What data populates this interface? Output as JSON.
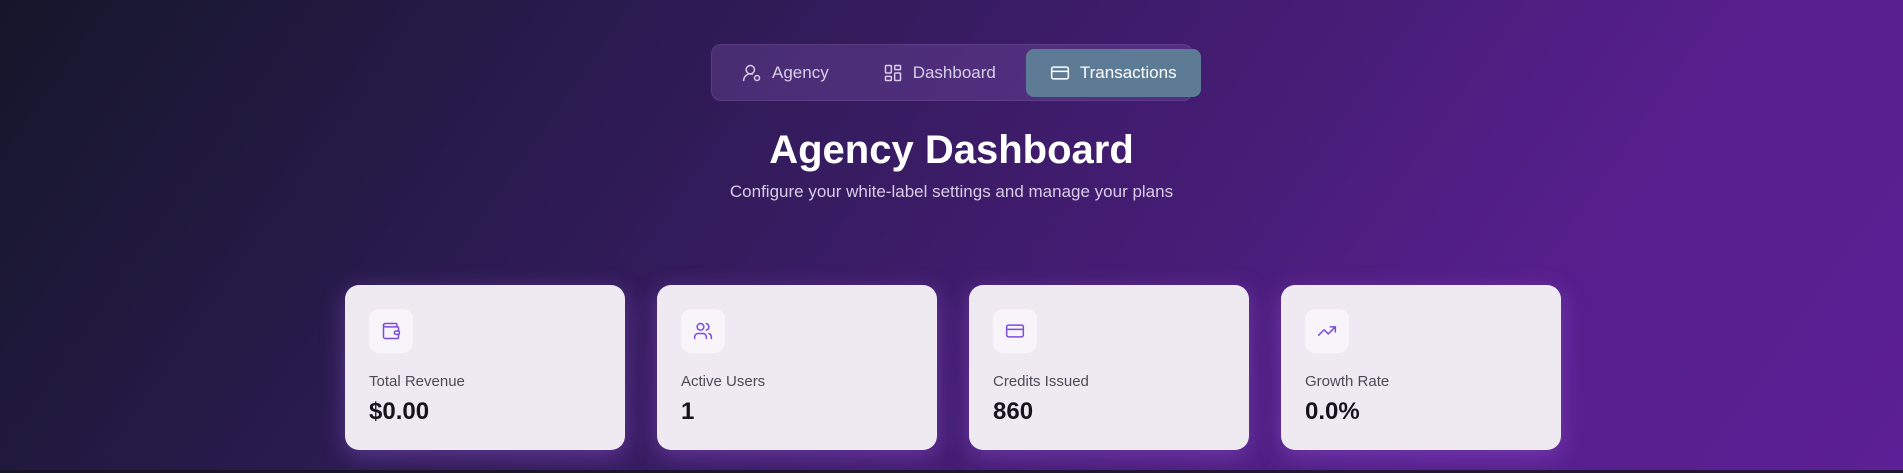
{
  "nav": {
    "tabs": [
      {
        "label": "Agency",
        "icon": "user-cog-icon",
        "active": false
      },
      {
        "label": "Dashboard",
        "icon": "grid-icon",
        "active": false
      },
      {
        "label": "Transactions",
        "icon": "credit-card-icon",
        "active": true
      }
    ]
  },
  "header": {
    "title": "Agency Dashboard",
    "subtitle": "Configure your white-label settings and manage your plans"
  },
  "stats": [
    {
      "label": "Total Revenue",
      "value": "$0.00",
      "icon": "wallet-icon"
    },
    {
      "label": "Active Users",
      "value": "1",
      "icon": "users-icon"
    },
    {
      "label": "Credits Issued",
      "value": "860",
      "icon": "credit-card-icon"
    },
    {
      "label": "Growth Rate",
      "value": "0.0%",
      "icon": "trending-up-icon"
    }
  ],
  "colors": {
    "accent": "#7c4ddc",
    "active_tab": "#5e7b96",
    "card_bg": "#efeaf2"
  }
}
